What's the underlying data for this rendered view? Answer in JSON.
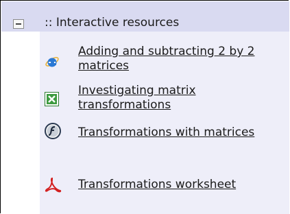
{
  "section": {
    "title": ":: Interactive resources"
  },
  "resources": [
    {
      "icon": "internet-explorer-icon",
      "label": "Adding and subtracting 2 by 2 matrices"
    },
    {
      "icon": "excel-icon",
      "label": "Investigating matrix transformations"
    },
    {
      "icon": "flash-icon",
      "label": "Transformations with matrices"
    },
    {
      "icon": "pdf-icon",
      "label": "Transformations worksheet"
    }
  ]
}
